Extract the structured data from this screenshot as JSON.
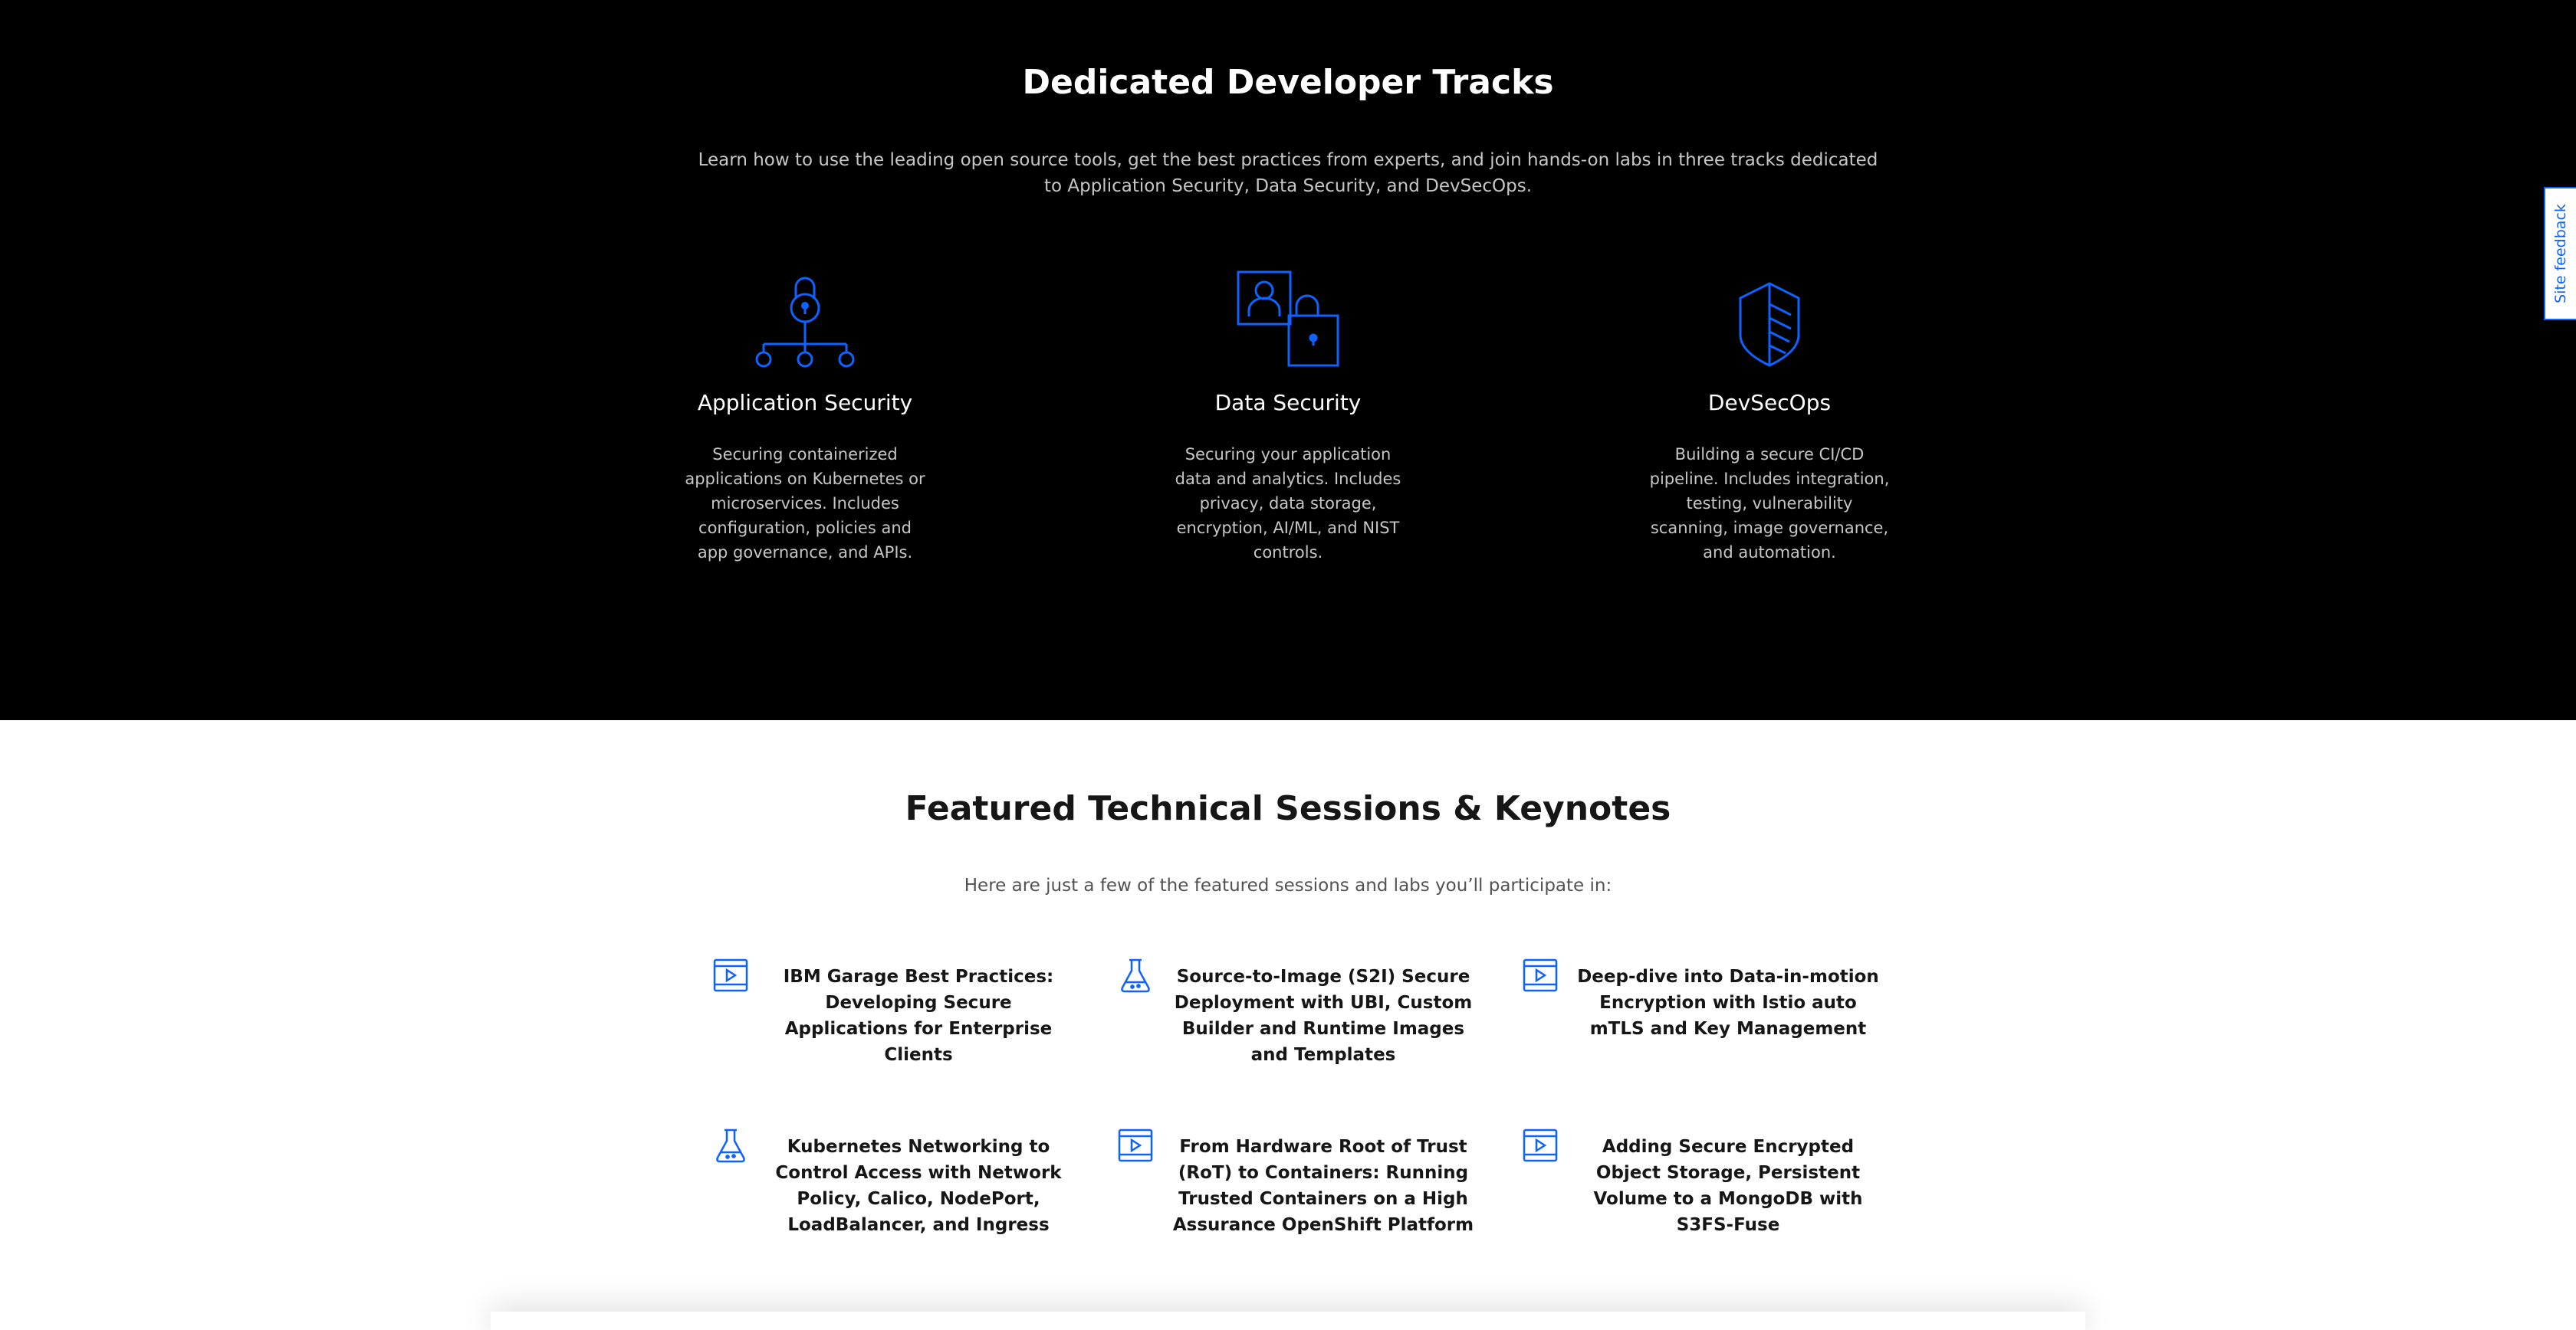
{
  "tracks": {
    "title": "Dedicated Developer Tracks",
    "intro": "Learn how to use the leading open source tools, get the best practices from experts, and join hands-on labs in three tracks dedicated to Application Security, Data Security, and DevSecOps.",
    "accent_color": "#0f62fe",
    "items": [
      {
        "icon": "lock-network-icon",
        "title": "Application Security",
        "description": "Securing containerized applications on Kubernetes or microservices. Includes configuration, policies and app governance, and APIs."
      },
      {
        "icon": "user-lock-icon",
        "title": "Data Security",
        "description": "Securing your application data and analytics. Includes privacy, data storage, encryption, AI/ML, and NIST controls."
      },
      {
        "icon": "shield-icon",
        "title": "DevSecOps",
        "description": "Building a secure CI/CD pipeline. Includes integration, testing, vulnerability scanning, image governance, and automation."
      }
    ]
  },
  "feedback": {
    "label": "Site feedback"
  },
  "sessions": {
    "title": "Featured Technical Sessions & Keynotes",
    "intro": "Here are just a few of the featured sessions and labs you’ll participate in:",
    "items": [
      {
        "icon": "video-icon",
        "title": "IBM Garage Best Practices: Developing Secure Applications for Enterprise Clients"
      },
      {
        "icon": "flask-icon",
        "title": "Source-to-Image (S2I) Secure Deployment with UBI, Custom Builder and Runtime Images and Templates"
      },
      {
        "icon": "video-icon",
        "title": "Deep-dive into Data-in-motion Encryption with Istio auto mTLS and Key Management"
      },
      {
        "icon": "flask-icon",
        "title": "Kubernetes Networking to Control Access with Network Policy, Calico, NodePort, LoadBalancer, and Ingress"
      },
      {
        "icon": "video-icon",
        "title": "From Hardware Root of Trust (RoT) to Containers: Running Trusted Containers on a High Assurance OpenShift Platform"
      },
      {
        "icon": "video-icon",
        "title": "Adding Secure Encrypted Object Storage, Persistent Volume to a MongoDB with S3FS-Fuse"
      }
    ]
  }
}
